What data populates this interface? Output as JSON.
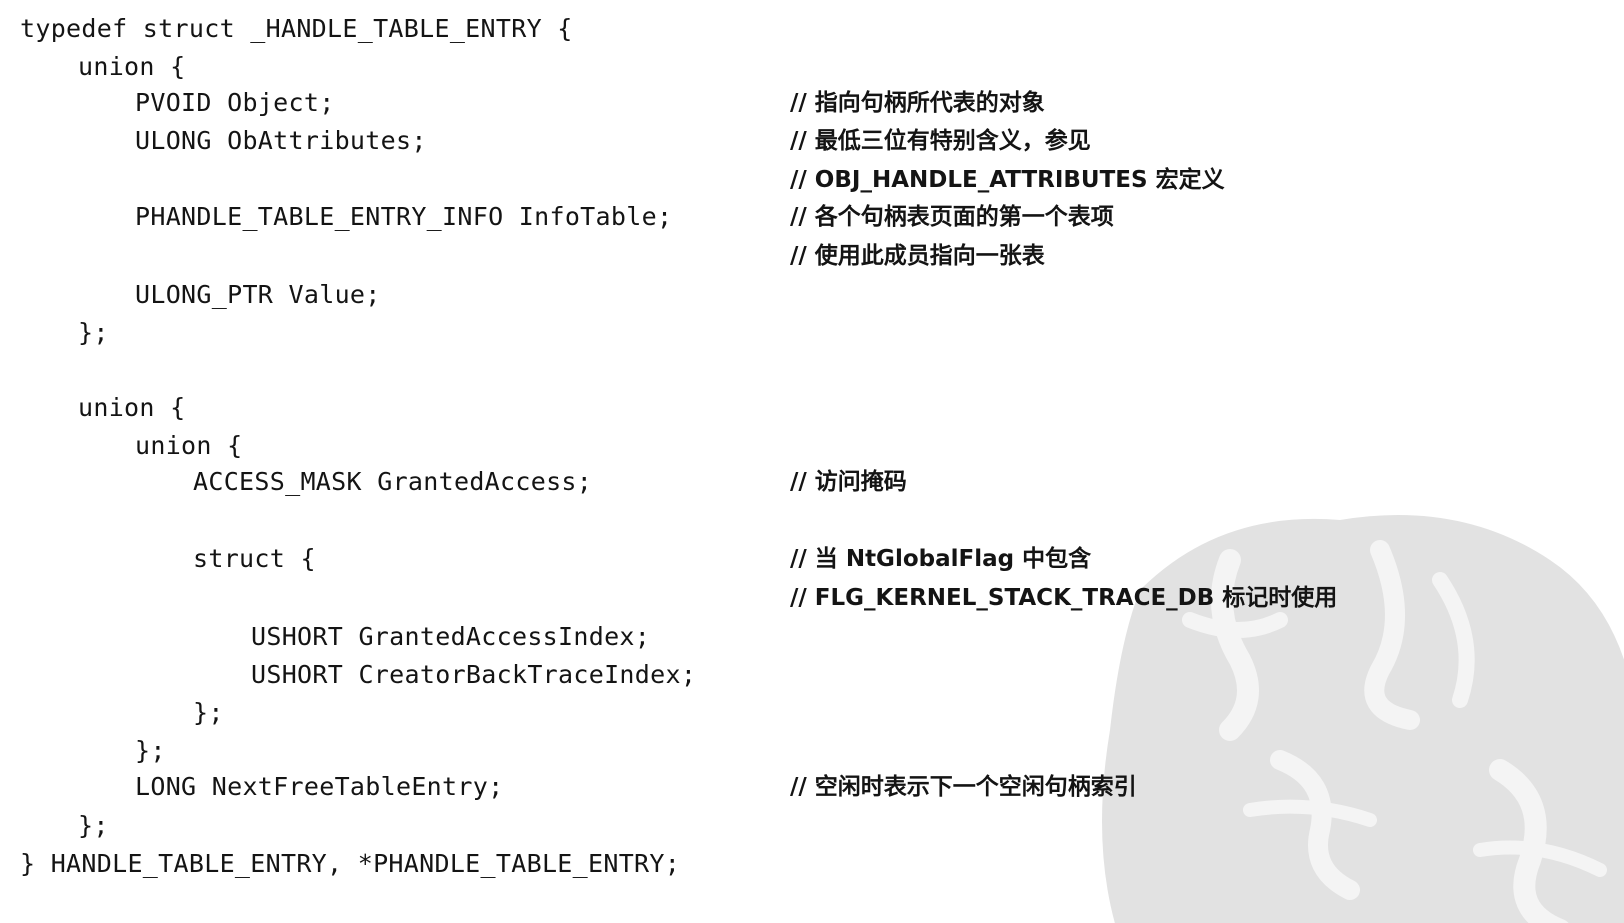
{
  "code": {
    "lines": [
      "typedef struct _HANDLE_TABLE_ENTRY {",
      "union {",
      "PVOID Object;",
      "ULONG ObAttributes;",
      "PHANDLE_TABLE_ENTRY_INFO InfoTable;",
      "ULONG_PTR Value;",
      "};",
      "union {",
      "union {",
      "ACCESS_MASK GrantedAccess;",
      "struct {",
      "USHORT GrantedAccessIndex;",
      "USHORT CreatorBackTraceIndex;",
      "};",
      "};",
      "LONG NextFreeTableEntry;",
      "};",
      "} HANDLE_TABLE_ENTRY, *PHANDLE_TABLE_ENTRY;"
    ],
    "comments": [
      "// 指向句柄所代表的对象",
      "// 最低三位有特别含义，参见",
      "// OBJ_HANDLE_ATTRIBUTES 宏定义",
      "// 各个句柄表页面的第一个表项",
      "// 使用此成员指向一张表",
      "// 访问掩码",
      "// 当 NtGlobalFlag 中包含",
      "// FLG_KERNEL_STACK_TRACE_DB 标记时使用",
      "// 空闲时表示下一个空闲句柄索引"
    ]
  },
  "watermark": {
    "icon": "calligraphy-seal-watermark",
    "color": "#dcdcdc"
  }
}
